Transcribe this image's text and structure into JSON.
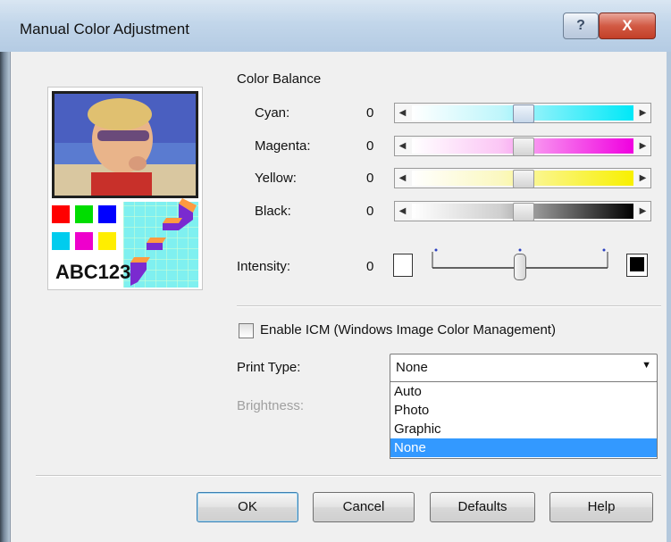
{
  "window": {
    "title": "Manual Color Adjustment"
  },
  "titlebar": {
    "help_label": "?",
    "close_label": "X"
  },
  "preview": {
    "sample_text": "ABC123"
  },
  "color_balance": {
    "heading": "Color Balance",
    "sliders": [
      {
        "label": "Cyan:",
        "value": "0",
        "color": "#00e8f8"
      },
      {
        "label": "Magenta:",
        "value": "0",
        "color": "#f000e0"
      },
      {
        "label": "Yellow:",
        "value": "0",
        "color": "#f8f000"
      },
      {
        "label": "Black:",
        "value": "0",
        "color": "#000000"
      }
    ]
  },
  "intensity": {
    "label": "Intensity:",
    "value": "0"
  },
  "icm": {
    "label": "Enable ICM (Windows Image Color Management)",
    "checked": false
  },
  "print_type": {
    "label": "Print Type:",
    "selected": "None",
    "options": [
      "Auto",
      "Photo",
      "Graphic",
      "None"
    ]
  },
  "brightness": {
    "label": "Brightness:"
  },
  "buttons": {
    "ok": "OK",
    "cancel": "Cancel",
    "defaults": "Defaults",
    "help": "Help"
  },
  "colors": {
    "selection": "#3399ff",
    "dialog_bg": "#f0f0f0"
  }
}
